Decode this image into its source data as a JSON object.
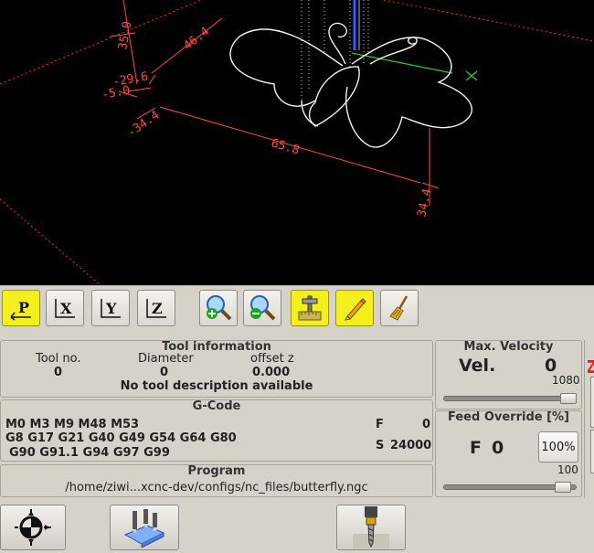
{
  "preview": {
    "dimensions": [
      "35.0",
      "46.4",
      "-29.6",
      "-5.0",
      "-34.4",
      "65.8",
      "34.4"
    ]
  },
  "toolbar": {
    "buttons": [
      {
        "label": "P",
        "icon": "view-p-icon"
      },
      {
        "label": "X",
        "icon": "view-x-icon"
      },
      {
        "label": "Y",
        "icon": "view-y-icon"
      },
      {
        "label": "Z",
        "icon": "view-z-icon"
      },
      {
        "icon": "zoom-in-icon"
      },
      {
        "icon": "zoom-out-icon"
      },
      {
        "icon": "dimensions-icon"
      },
      {
        "icon": "pencil-icon"
      },
      {
        "icon": "broom-icon"
      }
    ]
  },
  "tool_info": {
    "title": "Tool information",
    "tool_no_label": "Tool no.",
    "tool_no_value": "0",
    "diameter_label": "Diameter",
    "diameter_value": "0",
    "offset_label": "offset z",
    "offset_value": "0.000",
    "description": "No tool description available"
  },
  "gcode": {
    "title": "G-Code",
    "line1": "M0 M3 M9 M48 M53",
    "line2": "G8 G17 G21 G40 G49 G54 G64 G80",
    "line3": "G90 G91.1 G94 G97 G99",
    "f_label": "F",
    "f_value": "0",
    "s_label": "S",
    "s_value": "24000"
  },
  "program": {
    "title": "Program",
    "path": "/home/ziwi...xcnc-dev/configs/nc_files/butterfly.ngc"
  },
  "max_velocity": {
    "title": "Max. Velocity",
    "label": "Vel.",
    "value": "0",
    "max": "1080",
    "fraction": 1.0
  },
  "feed_override": {
    "title": "Feed Override [%]",
    "label": "F",
    "value": "0",
    "button_label": "100%",
    "scale": "100",
    "fraction": 0.95
  },
  "colors": {
    "accent_yellow": "#f3f01e",
    "preview_dimension": "#ff4a4a",
    "background": "#d6d2c9"
  }
}
